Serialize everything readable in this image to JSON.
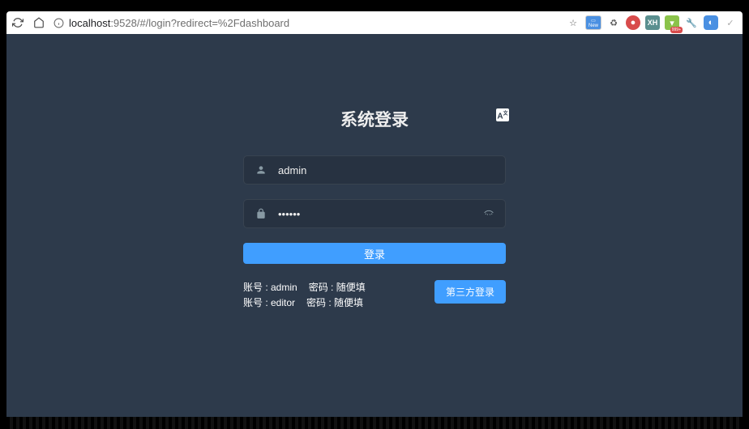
{
  "browser": {
    "url_host": "localhost",
    "url_path": ":9528/#/login?redirect=%2Fdashboard"
  },
  "login": {
    "title": "系统登录",
    "lang_icon": "A",
    "username_value": "admin",
    "password_value": "111111",
    "login_btn": "登录",
    "tips": {
      "line1_user": "账号 : admin",
      "line1_pass": "密码 : 随便填",
      "line2_user": "账号 : editor",
      "line2_pass": "密码 : 随便填"
    },
    "third_party_btn": "第三方登录"
  },
  "colors": {
    "bg": "#2d3a4b",
    "primary": "#409eff",
    "icon": "#889aa4"
  }
}
